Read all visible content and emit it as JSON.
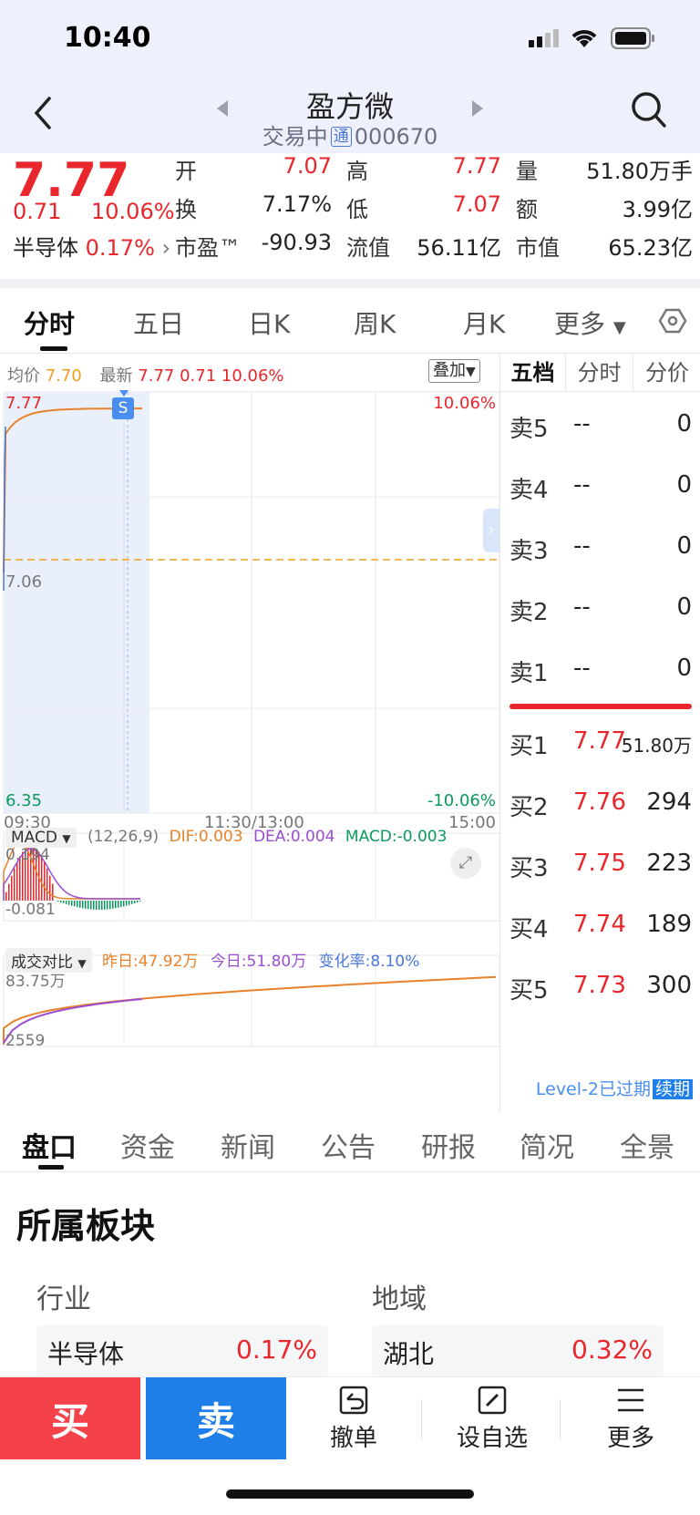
{
  "status": {
    "time": "10:40"
  },
  "header": {
    "name": "盈方微",
    "status_text": "交易中",
    "tong": "通",
    "code": "000670"
  },
  "quote": {
    "price": "7.77",
    "change": "0.71",
    "change_pct": "10.06%",
    "sector": "半导体",
    "sector_pct": "0.17%",
    "open_label": "开",
    "open": "7.07",
    "high_label": "高",
    "high": "7.77",
    "volume_label": "量",
    "volume": "51.80万手",
    "turnover_label": "换",
    "turnover": "7.17%",
    "low_label": "低",
    "low": "7.07",
    "amount_label": "额",
    "amount": "3.99亿",
    "pe_label": "市盈™",
    "pe": "-90.93",
    "float_cap_label": "流值",
    "float_cap": "56.11亿",
    "market_cap_label": "市值",
    "market_cap": "65.23亿"
  },
  "tabs": [
    "分时",
    "五日",
    "日K",
    "周K",
    "月K",
    "更多"
  ],
  "chart": {
    "avg_label": "均价",
    "avg": "7.70",
    "latest_label": "最新",
    "latest": "7.77",
    "latest_change": "0.71",
    "latest_pct": "10.06%",
    "overlay_label": "叠加",
    "y_top": "7.77",
    "y_mid": "7.06",
    "y_bottom": "6.35",
    "pct_top": "10.06%",
    "pct_bottom": "-10.06%",
    "t_start": "09:30",
    "t_mid": "11:30/13:00",
    "t_end": "15:00",
    "s_badge": "S",
    "macd_label": "MACD",
    "macd_params": "(12,26,9)",
    "dif": "DIF:0.003",
    "dea": "DEA:0.004",
    "macd_val": "MACD:-0.003",
    "macd_top": "0.194",
    "macd_bottom": "-0.081",
    "vol_label": "成交对比",
    "yesterday": "昨日:47.92万",
    "today": "今日:51.80万",
    "change_rate": "变化率:8.10%",
    "vol_top": "83.75万",
    "vol_bottom": "2559"
  },
  "colors": {
    "up": "#e8262b",
    "down": "#0b9a5b",
    "price_line": "#e8822b",
    "avg_line": "#f0a020",
    "accent": "#1e7fe8"
  },
  "order_book": {
    "tabs": [
      "五档",
      "分时",
      "分价"
    ],
    "sells": [
      {
        "label": "卖5",
        "price": "--",
        "vol": "0"
      },
      {
        "label": "卖4",
        "price": "--",
        "vol": "0"
      },
      {
        "label": "卖3",
        "price": "--",
        "vol": "0"
      },
      {
        "label": "卖2",
        "price": "--",
        "vol": "0"
      },
      {
        "label": "卖1",
        "price": "--",
        "vol": "0"
      }
    ],
    "buys": [
      {
        "label": "买1",
        "price": "7.77",
        "vol": "51.80万"
      },
      {
        "label": "买2",
        "price": "7.76",
        "vol": "294"
      },
      {
        "label": "买3",
        "price": "7.75",
        "vol": "223"
      },
      {
        "label": "买4",
        "price": "7.74",
        "vol": "189"
      },
      {
        "label": "买5",
        "price": "7.73",
        "vol": "300"
      }
    ],
    "level2": "Level-2已过期",
    "renew": "续期"
  },
  "bottom_tabs": [
    "盘口",
    "资金",
    "新闻",
    "公告",
    "研报",
    "简况",
    "全景"
  ],
  "sectors": {
    "title": "所属板块",
    "industry_label": "行业",
    "industry_name": "半导体",
    "industry_pct": "0.17%",
    "region_label": "地域",
    "region_name": "湖北",
    "region_pct": "0.32%"
  },
  "actions": {
    "buy": "买",
    "sell": "卖",
    "cancel": "撤单",
    "watchlist": "设自选",
    "more": "更多"
  }
}
